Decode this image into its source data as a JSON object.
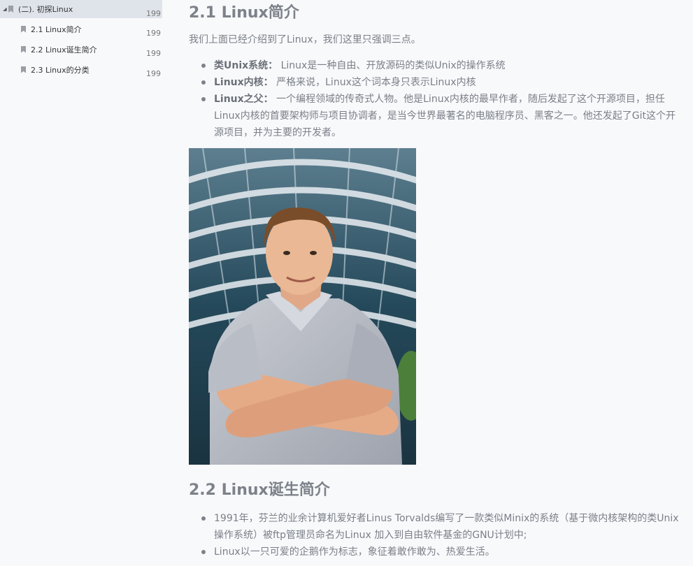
{
  "sidebar": {
    "items": [
      {
        "label": "(二). 初探Linux",
        "page": "199"
      },
      {
        "label": "2.1 Linux简介",
        "page": "199"
      },
      {
        "label": "2.2 Linux诞生简介",
        "page": "199"
      },
      {
        "label": "2.3 Linux的分类",
        "page": "199"
      }
    ]
  },
  "content": {
    "section1_title": "2.1 Linux简介",
    "intro": "我们上面已经介绍到了Linux，我们这里只强调三点。",
    "bullets1": [
      {
        "term": "类Unix系统：",
        "text": " Linux是一种自由、开放源码的类似Unix的操作系统"
      },
      {
        "term": "Linux内核：",
        "text": " 严格来说，Linux这个词本身只表示Linux内核"
      },
      {
        "term": "Linux之父：",
        "text": " 一个编程领域的传奇式人物。他是Linux内核的最早作者，随后发起了这个开源项目，担任Linux内核的首要架构师与项目协调者，是当今世界最著名的电脑程序员、黑客之一。他还发起了Git这个开源项目，并为主要的开发者。"
      }
    ],
    "section2_title": "2.2 Linux诞生简介",
    "bullets2": [
      "1991年，芬兰的业余计算机爱好者Linus Torvalds编写了一款类似Minix的系统（基于微内核架构的类Unix操作系统）被ftp管理员命名为Linux 加入到自由软件基金的GNU计划中;",
      "Linux以一只可爱的企鹅作为标志，象征着敢作敢为、热爱生活。"
    ]
  }
}
